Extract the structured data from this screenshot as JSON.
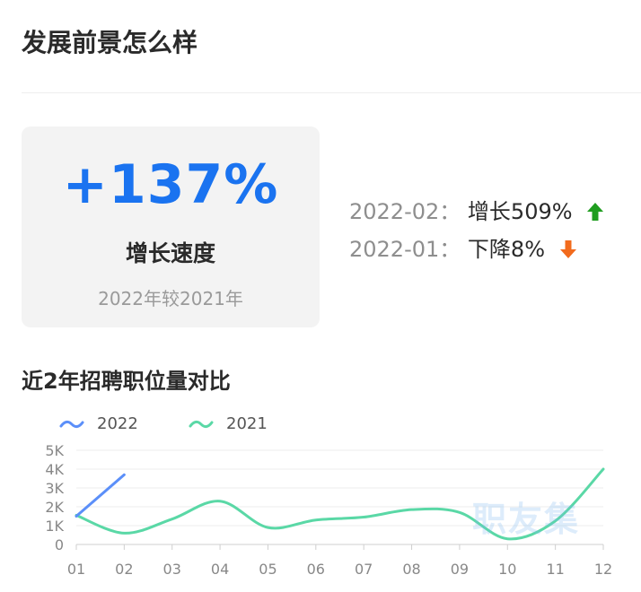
{
  "header": {
    "title": "发展前景怎么样"
  },
  "growth_card": {
    "value": "+137%",
    "label": "增长速度",
    "subtitle": "2022年较2021年"
  },
  "monthly_changes": [
    {
      "date": "2022-02：",
      "text": "增长509%",
      "direction": "up",
      "icon": "arrow-up-icon",
      "color": "#1f9d1f"
    },
    {
      "date": "2022-01：",
      "text": "下降8%",
      "direction": "down",
      "icon": "arrow-down-icon",
      "color": "#f26b1d"
    }
  ],
  "chart_section": {
    "title": "近2年招聘职位量对比"
  },
  "watermark": "职友集",
  "chart_data": {
    "type": "line",
    "categories": [
      "01",
      "02",
      "03",
      "04",
      "05",
      "06",
      "07",
      "08",
      "09",
      "10",
      "11",
      "12"
    ],
    "yticks": [
      "0",
      "1K",
      "2K",
      "3K",
      "4K",
      "5K"
    ],
    "ylim": [
      0,
      5000
    ],
    "series": [
      {
        "name": "2022",
        "color": "#5b8ff9",
        "smooth": false,
        "values": [
          1500,
          3700
        ]
      },
      {
        "name": "2021",
        "color": "#5ad8a6",
        "smooth": true,
        "values": [
          1550,
          600,
          1350,
          2300,
          900,
          1300,
          1450,
          1850,
          1700,
          300,
          1250,
          4000
        ]
      }
    ],
    "grid": true,
    "legend": "top-left"
  }
}
